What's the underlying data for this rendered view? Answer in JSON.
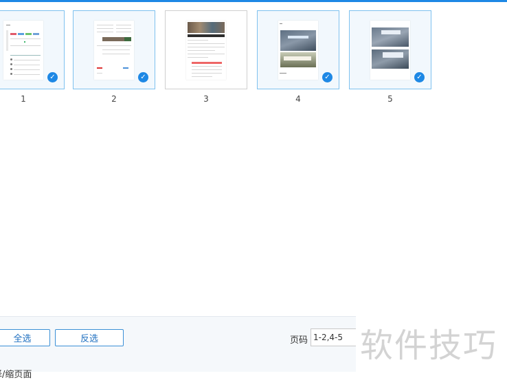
{
  "thumbnails": [
    {
      "number": "1",
      "selected": true
    },
    {
      "number": "2",
      "selected": true
    },
    {
      "number": "3",
      "selected": false
    },
    {
      "number": "4",
      "selected": true
    },
    {
      "number": "5",
      "selected": true
    }
  ],
  "footer": {
    "select_all_label": "全选",
    "invert_label": "反选",
    "page_range_label": "页码",
    "page_range_value": "1-2,4-5",
    "partial_text": "择/缩页面"
  },
  "watermark_text": "软件技巧",
  "icons": {
    "check": "checkmark-icon"
  },
  "colors": {
    "accent": "#1e88e5",
    "selected_border": "#7ec1ef",
    "selected_bg": "#f2f8fd"
  }
}
